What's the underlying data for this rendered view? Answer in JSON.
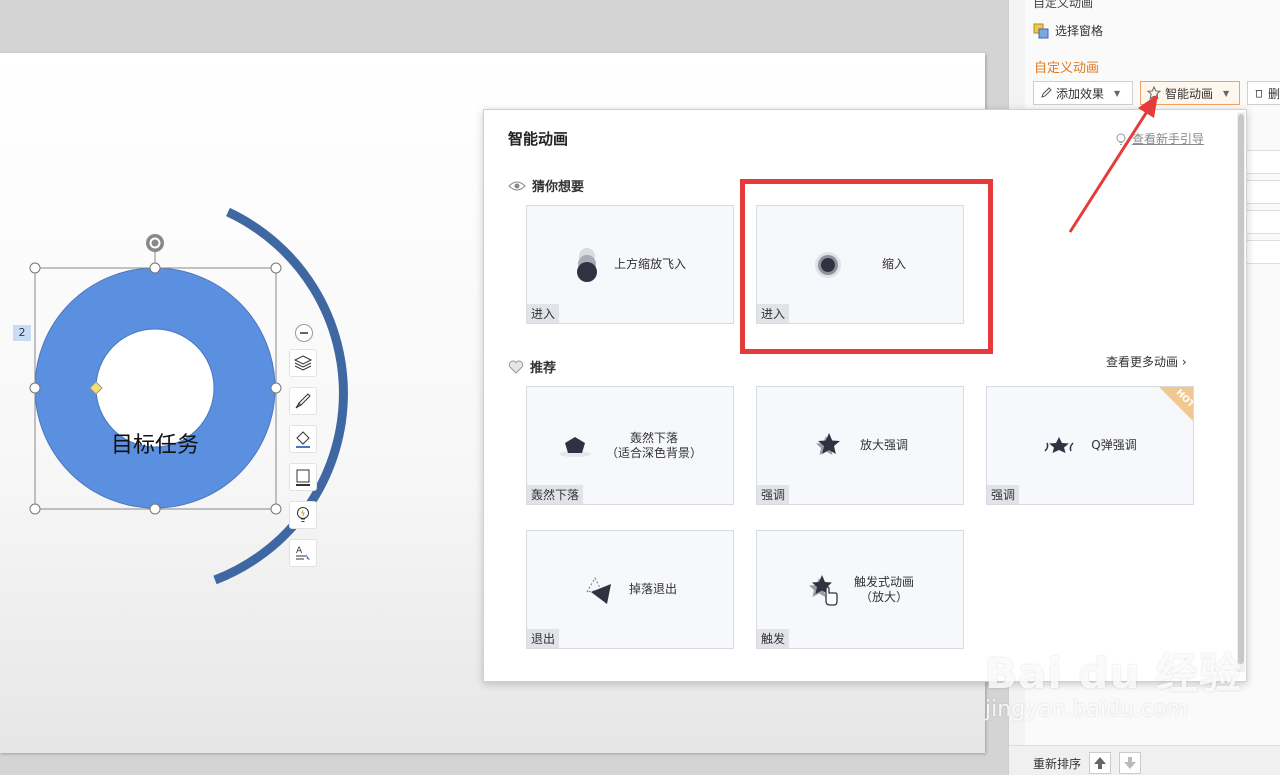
{
  "slide": {
    "shape_text": "目标任务",
    "order_badge": "2"
  },
  "panel": {
    "top_label": "自定义动画",
    "select_pane": "选择窗格",
    "section_title": "自定义动画",
    "add_effect": "添加效果",
    "smart_animation": "智能动画",
    "delete_label": "删",
    "reorder_label": "重新排序"
  },
  "popup": {
    "title": "智能动画",
    "guide_link": "查看新手引导",
    "guess_label": "猜你想要",
    "recommend_label": "推荐",
    "more_link": "查看更多动画 ›",
    "guess_cards": [
      {
        "title": "上方缩放飞入",
        "category": "进入"
      },
      {
        "title": "缩入",
        "category": "进入"
      }
    ],
    "recommend_cards": [
      {
        "title_line1": "轰然下落",
        "title_line2": "（适合深色背景）",
        "category": "轰然下落"
      },
      {
        "title_line1": "放大强调",
        "category": "强调"
      },
      {
        "title_line1": "Q弹强调",
        "category": "强调",
        "badge": "HOT"
      },
      {
        "title_line1": "掉落退出",
        "category": "退出"
      },
      {
        "title_line1": "触发式动画",
        "title_line2": "（放大）",
        "category": "触发"
      }
    ]
  },
  "watermark": {
    "brand": "Bai du 经验",
    "url": "jingyan.baidu.com"
  },
  "colors": {
    "ring": "#5b8fdf",
    "arc": "#3f68a3",
    "highlight": "#e53b3b",
    "accent": "#e07a1f"
  }
}
